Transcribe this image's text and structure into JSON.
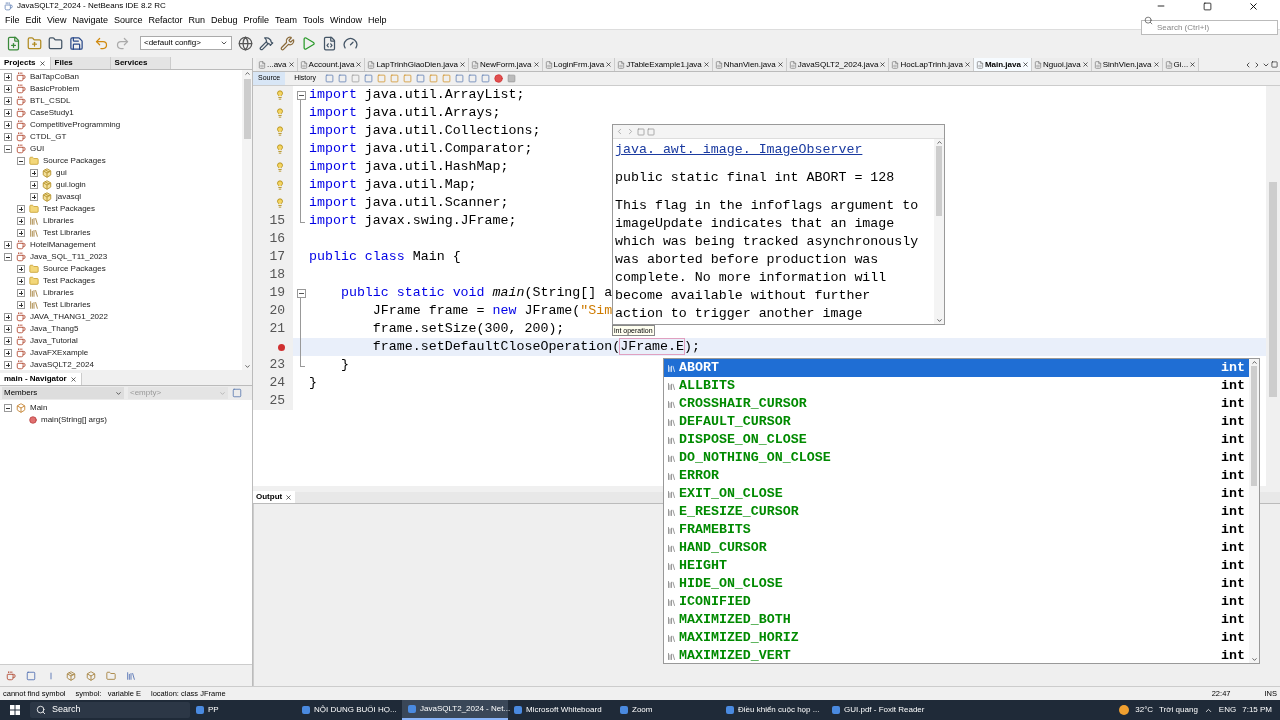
{
  "window": {
    "title": "JavaSQLT2_2024 - NetBeans IDE 8.2 RC"
  },
  "menu": [
    "File",
    "Edit",
    "View",
    "Navigate",
    "Source",
    "Refactor",
    "Run",
    "Debug",
    "Profile",
    "Team",
    "Tools",
    "Window",
    "Help"
  ],
  "search": {
    "placeholder": "Search (Ctrl+I)"
  },
  "toolbar": {
    "config": "<default config>"
  },
  "projects_panel": {
    "tabs": [
      {
        "label": "Projects",
        "selected": true
      },
      {
        "label": "Files",
        "selected": false
      },
      {
        "label": "Services",
        "selected": false
      }
    ],
    "tree": [
      {
        "label": "BaiTapCoBan",
        "kind": "project",
        "expanded": false
      },
      {
        "label": "BasicProblem",
        "kind": "project",
        "expanded": false
      },
      {
        "label": "BTL_CSDL",
        "kind": "project",
        "expanded": false
      },
      {
        "label": "CaseStudy1",
        "kind": "project",
        "expanded": false
      },
      {
        "label": "CompetitiveProgramming",
        "kind": "project",
        "expanded": false
      },
      {
        "label": "CTDL_GT",
        "kind": "project",
        "expanded": false
      },
      {
        "label": "GUI",
        "kind": "project",
        "expanded": true,
        "children": [
          {
            "label": "Source Packages",
            "kind": "folder",
            "expanded": true,
            "children": [
              {
                "label": "gui",
                "kind": "package",
                "expanded": false
              },
              {
                "label": "gui.login",
                "kind": "package",
                "expanded": false
              },
              {
                "label": "javasql",
                "kind": "package",
                "expanded": false
              }
            ]
          },
          {
            "label": "Test Packages",
            "kind": "folder",
            "expanded": false
          },
          {
            "label": "Libraries",
            "kind": "library",
            "expanded": false
          },
          {
            "label": "Test Libraries",
            "kind": "library",
            "expanded": false
          }
        ]
      },
      {
        "label": "HotelManagement",
        "kind": "project",
        "expanded": false
      },
      {
        "label": "Java_SQL_T11_2023",
        "kind": "project",
        "expanded": true,
        "children": [
          {
            "label": "Source Packages",
            "kind": "folder",
            "expanded": false
          },
          {
            "label": "Test Packages",
            "kind": "folder",
            "expanded": false
          },
          {
            "label": "Libraries",
            "kind": "library",
            "expanded": false
          },
          {
            "label": "Test Libraries",
            "kind": "library",
            "expanded": false
          }
        ]
      },
      {
        "label": "JAVA_THANG1_2022",
        "kind": "project",
        "expanded": false
      },
      {
        "label": "Java_Thang5",
        "kind": "project",
        "expanded": false
      },
      {
        "label": "Java_Tutorial",
        "kind": "project",
        "expanded": false
      },
      {
        "label": "JavaFXExample",
        "kind": "project",
        "expanded": false
      },
      {
        "label": "JavaSQLT2_2024",
        "kind": "project",
        "expanded": false
      }
    ]
  },
  "navigator": {
    "title": "main - Navigator",
    "filter": "Members",
    "second_filter": "<empty>",
    "tree": [
      {
        "label": "Main",
        "kind": "class",
        "expanded": true,
        "children": [
          {
            "label": "main(String[] args)",
            "kind": "method"
          }
        ]
      }
    ]
  },
  "editor_tabs": [
    {
      "label": "...ava",
      "selected": false
    },
    {
      "label": "Account.java",
      "selected": false
    },
    {
      "label": "LapTrinhGiaoDien.java",
      "selected": false
    },
    {
      "label": "NewForm.java",
      "selected": false
    },
    {
      "label": "LoginFrm.java",
      "selected": false
    },
    {
      "label": "JTableExample1.java",
      "selected": false
    },
    {
      "label": "NhanVien.java",
      "selected": false
    },
    {
      "label": "JavaSQLT2_2024.java",
      "selected": false
    },
    {
      "label": "HocLapTrinh.java",
      "selected": false
    },
    {
      "label": "Main.java",
      "selected": true
    },
    {
      "label": "Nguoi.java",
      "selected": false
    },
    {
      "label": "SinhVien.java",
      "selected": false
    },
    {
      "label": "Gi...",
      "selected": false
    }
  ],
  "editor_views": [
    {
      "label": "Source",
      "selected": true
    },
    {
      "label": "History",
      "selected": false
    }
  ],
  "code_lines": [
    {
      "marker": {
        "kind": "warning"
      },
      "fold": {
        "kind": "start"
      },
      "current": false,
      "tokens": [
        {
          "text": "import",
          "kind": "keyword"
        },
        {
          "text": " java.util.ArrayList;",
          "kind": "plain"
        }
      ]
    },
    {
      "marker": {
        "kind": "warning"
      },
      "fold": {
        "kind": "inner"
      },
      "current": false,
      "tokens": [
        {
          "text": "import",
          "kind": "keyword"
        },
        {
          "text": " java.util.Arrays;",
          "kind": "plain"
        }
      ]
    },
    {
      "marker": {
        "kind": "warning"
      },
      "fold": {
        "kind": "inner"
      },
      "current": false,
      "tokens": [
        {
          "text": "import",
          "kind": "keyword"
        },
        {
          "text": " java.util.Collections;",
          "kind": "plain"
        }
      ]
    },
    {
      "marker": {
        "kind": "warning"
      },
      "fold": {
        "kind": "inner"
      },
      "current": false,
      "tokens": [
        {
          "text": "import",
          "kind": "keyword"
        },
        {
          "text": " java.util.Comparator;",
          "kind": "plain"
        }
      ]
    },
    {
      "marker": {
        "kind": "warning"
      },
      "fold": {
        "kind": "inner"
      },
      "current": false,
      "tokens": [
        {
          "text": "import",
          "kind": "keyword"
        },
        {
          "text": " java.util.HashMap;",
          "kind": "plain"
        }
      ]
    },
    {
      "marker": {
        "kind": "warning"
      },
      "fold": {
        "kind": "inner"
      },
      "current": false,
      "tokens": [
        {
          "text": "import",
          "kind": "keyword"
        },
        {
          "text": " java.util.Map;",
          "kind": "plain"
        }
      ]
    },
    {
      "marker": {
        "kind": "warning"
      },
      "fold": {
        "kind": "inner"
      },
      "current": false,
      "tokens": [
        {
          "text": "import",
          "kind": "keyword"
        },
        {
          "text": " java.util.Scanner;",
          "kind": "plain"
        }
      ]
    },
    {
      "number": "15",
      "fold": {
        "kind": "end"
      },
      "current": false,
      "tokens": [
        {
          "text": "import",
          "kind": "keyword"
        },
        {
          "text": " javax.swing.JFrame;",
          "kind": "plain"
        }
      ]
    },
    {
      "number": "16",
      "current": false
    },
    {
      "number": "17",
      "current": false,
      "tokens": [
        {
          "text": "public class",
          "kind": "keyword"
        },
        {
          "text": " Main {",
          "kind": "plain"
        }
      ]
    },
    {
      "number": "18",
      "current": false
    },
    {
      "number": "19",
      "fold": {
        "kind": "start"
      },
      "current": false,
      "tokens": [
        {
          "text": "    public static void",
          "kind": "keyword"
        },
        {
          "text": " main",
          "kind": "italic"
        },
        {
          "text": "(String[] a",
          "kind": "plain"
        }
      ]
    },
    {
      "number": "20",
      "fold": {
        "kind": "inner"
      },
      "current": false,
      "tokens": [
        {
          "text": "        JFrame frame = ",
          "kind": "plain"
        },
        {
          "text": "new",
          "kind": "keyword"
        },
        {
          "text": " JFrame(",
          "kind": "plain"
        },
        {
          "text": "\"Sim",
          "kind": "string"
        }
      ]
    },
    {
      "number": "21",
      "fold": {
        "kind": "inner"
      },
      "current": false,
      "tokens": [
        {
          "text": "        frame.setSize(300, 200);",
          "kind": "plain"
        }
      ]
    },
    {
      "marker": {
        "kind": "error"
      },
      "fold": {
        "kind": "inner"
      },
      "current": true,
      "tokens": [
        {
          "text": "        frame.setDefaultCloseOperation(",
          "kind": "plain"
        },
        {
          "text": "JFrame.E",
          "kind": "boxed"
        },
        {
          "text": ");",
          "kind": "plain"
        }
      ]
    },
    {
      "number": "23",
      "fold": {
        "kind": "end"
      },
      "current": false,
      "tokens": [
        {
          "text": "    }",
          "kind": "plain"
        }
      ]
    },
    {
      "number": "24",
      "current": false,
      "tokens": [
        {
          "text": "}",
          "kind": "plain"
        }
      ]
    },
    {
      "number": "25",
      "current": false
    }
  ],
  "javadoc": {
    "link": "java. awt. image. ImageObserver",
    "signature": "public static final int ABORT = 128",
    "text": "This flag in the infoflags argument to imageUpdate indicates that an image which was being tracked asynchronously was aborted before production was complete. No more information will become available without further action to trigger another image"
  },
  "tooltip": "int operation",
  "completion": [
    {
      "name": "ABORT",
      "type": "int",
      "selected": true
    },
    {
      "name": "ALLBITS",
      "type": "int",
      "selected": false
    },
    {
      "name": "CROSSHAIR_CURSOR",
      "type": "int",
      "selected": false
    },
    {
      "name": "DEFAULT_CURSOR",
      "type": "int",
      "selected": false
    },
    {
      "name": "DISPOSE_ON_CLOSE",
      "type": "int",
      "selected": false
    },
    {
      "name": "DO_NOTHING_ON_CLOSE",
      "type": "int",
      "selected": false
    },
    {
      "name": "ERROR",
      "type": "int",
      "selected": false
    },
    {
      "name": "EXIT_ON_CLOSE",
      "type": "int",
      "selected": false
    },
    {
      "name": "E_RESIZE_CURSOR",
      "type": "int",
      "selected": false
    },
    {
      "name": "FRAMEBITS",
      "type": "int",
      "selected": false
    },
    {
      "name": "HAND_CURSOR",
      "type": "int",
      "selected": false
    },
    {
      "name": "HEIGHT",
      "type": "int",
      "selected": false
    },
    {
      "name": "HIDE_ON_CLOSE",
      "type": "int",
      "selected": false
    },
    {
      "name": "ICONIFIED",
      "type": "int",
      "selected": false
    },
    {
      "name": "MAXIMIZED_BOTH",
      "type": "int",
      "selected": false
    },
    {
      "name": "MAXIMIZED_HORIZ",
      "type": "int",
      "selected": false
    },
    {
      "name": "MAXIMIZED_VERT",
      "type": "int",
      "selected": false
    }
  ],
  "output": {
    "title": "Output"
  },
  "status_bar": {
    "messages": [
      "cannot find symbol",
      "symbol:   variable E",
      "location: class JFrame"
    ],
    "position": "22:47",
    "mode": "INS"
  },
  "taskbar": {
    "search": "Search",
    "apps": [
      {
        "label": "PP",
        "selected": false
      },
      {
        "label": "NỘI DUNG BUỔI HỌ...",
        "selected": false
      },
      {
        "label": "JavaSQLT2_2024 - Net...",
        "selected": true
      },
      {
        "label": "Microsoft Whiteboard",
        "selected": false
      },
      {
        "label": "Zoom",
        "selected": false
      },
      {
        "label": "Điều khiển cuộc họp ...",
        "selected": false
      },
      {
        "label": "GUI.pdf - Foxit Reader",
        "selected": false
      }
    ],
    "temperature": "32°C",
    "weather": "Trời quang",
    "language": "ENG",
    "time": "7:15 PM"
  }
}
